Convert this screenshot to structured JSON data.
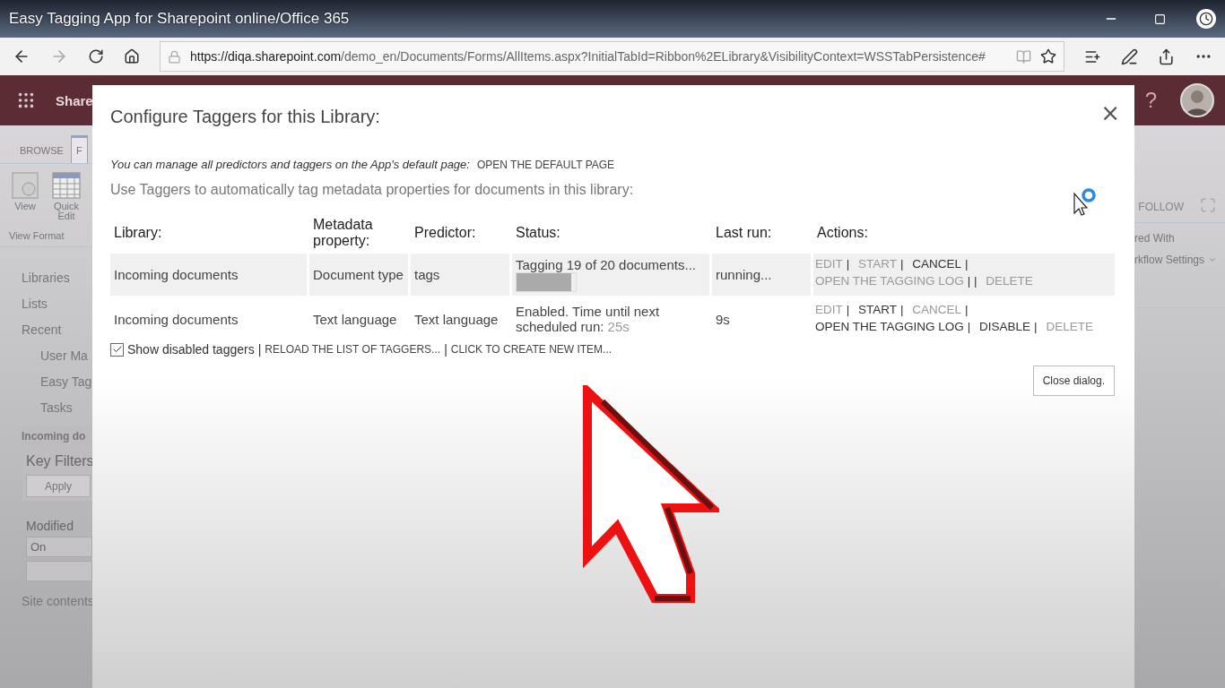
{
  "video_title": "Easy Tagging App for Sharepoint online/Office 365",
  "address": {
    "host": "https://diqa.sharepoint.com",
    "path": "/demo_en/Documents/Forms/AllItems.aspx?InitialTabId=Ribbon%2ELibrary&VisibilityContext=WSSTabPersistence#"
  },
  "suite_bar": {
    "brand": "Share",
    "help": "?"
  },
  "ribbon": {
    "tabs": [
      {
        "label": "BROWSE",
        "selected": false
      },
      {
        "label": "F",
        "selected": true
      }
    ],
    "buttons": [
      {
        "label": "View",
        "kind": "view"
      },
      {
        "label": "Quick Edit",
        "kind": "grid"
      }
    ],
    "group_label": "View Format",
    "right_tab": "FOLLOW",
    "right_items": [
      {
        "label": "red With",
        "kind": "plain"
      },
      {
        "label": "rkflow Settings",
        "kind": "dropdown"
      }
    ]
  },
  "nav": {
    "items": [
      {
        "label": "Libraries",
        "current": false
      },
      {
        "label": "Lists",
        "current": false
      },
      {
        "label": "Recent",
        "current": false,
        "children": [
          {
            "label": "User Ma"
          },
          {
            "label": "Easy Tag"
          },
          {
            "label": "Tasks"
          }
        ]
      },
      {
        "label": "Incoming do",
        "current": true
      }
    ],
    "key_filters": {
      "title": "Key Filters",
      "apply": "Apply",
      "field_label": "Modified",
      "fields": [
        {
          "value": "On"
        }
      ],
      "empty_field": true
    },
    "footer_link": "Site contents"
  },
  "dialog": {
    "title": "Configure Taggers for this Library:",
    "close": "×",
    "note": "You can manage all predictors and taggers on the App's default page:",
    "note_link": "OPEN THE DEFAULT PAGE",
    "intro": "Use Taggers to automatically tag metadata properties for documents in this library:",
    "columns": [
      "Library:",
      "Metadata property:",
      "Predictor:",
      "Status:",
      "Last run:",
      "Actions:"
    ],
    "rows": [
      {
        "active": true,
        "library": "Incoming documents",
        "property": "Document type",
        "predictor": "tags",
        "status": {
          "kind": "progress",
          "text": "Tagging 19 of 20 documents...",
          "level": 0.93
        },
        "last_run": "running...",
        "actions": [
          {
            "label": "EDIT",
            "enabled": false,
            "sep": "|"
          },
          {
            "label": "START",
            "enabled": false,
            "sep": "|"
          },
          {
            "label": "CANCEL",
            "enabled": true,
            "sep": "|"
          },
          {
            "label": "OPEN THE TAGGING LOG",
            "enabled": false,
            "sep": "| |"
          },
          {
            "label": "DELETE",
            "enabled": false
          }
        ]
      },
      {
        "active": false,
        "library": "Incoming documents",
        "property": "Text language",
        "predictor": "Text language",
        "status": {
          "kind": "scheduled",
          "text": "Enabled. Time until next scheduled run:",
          "countdown": "25s"
        },
        "last_run": "9s",
        "actions": [
          {
            "label": "EDIT",
            "enabled": false,
            "sep": "|"
          },
          {
            "label": "START",
            "enabled": true,
            "sep": "|"
          },
          {
            "label": "CANCEL",
            "enabled": false,
            "sep": "|"
          },
          {
            "label": "OPEN THE TAGGING LOG",
            "enabled": true,
            "sep": "|"
          },
          {
            "label": "DISABLE",
            "enabled": true,
            "sep": "|"
          },
          {
            "label": "DELETE",
            "enabled": false
          }
        ]
      }
    ],
    "show_disabled": {
      "label": "Show disabled taggers",
      "checked": true
    },
    "footer_links": [
      {
        "sep": "|",
        "label": "RELOAD THE LIST OF TAGGERS..."
      },
      {
        "sep": "|",
        "label": "CLICK TO CREATE NEW ITEM..."
      }
    ],
    "close_button": "Close dialog."
  }
}
